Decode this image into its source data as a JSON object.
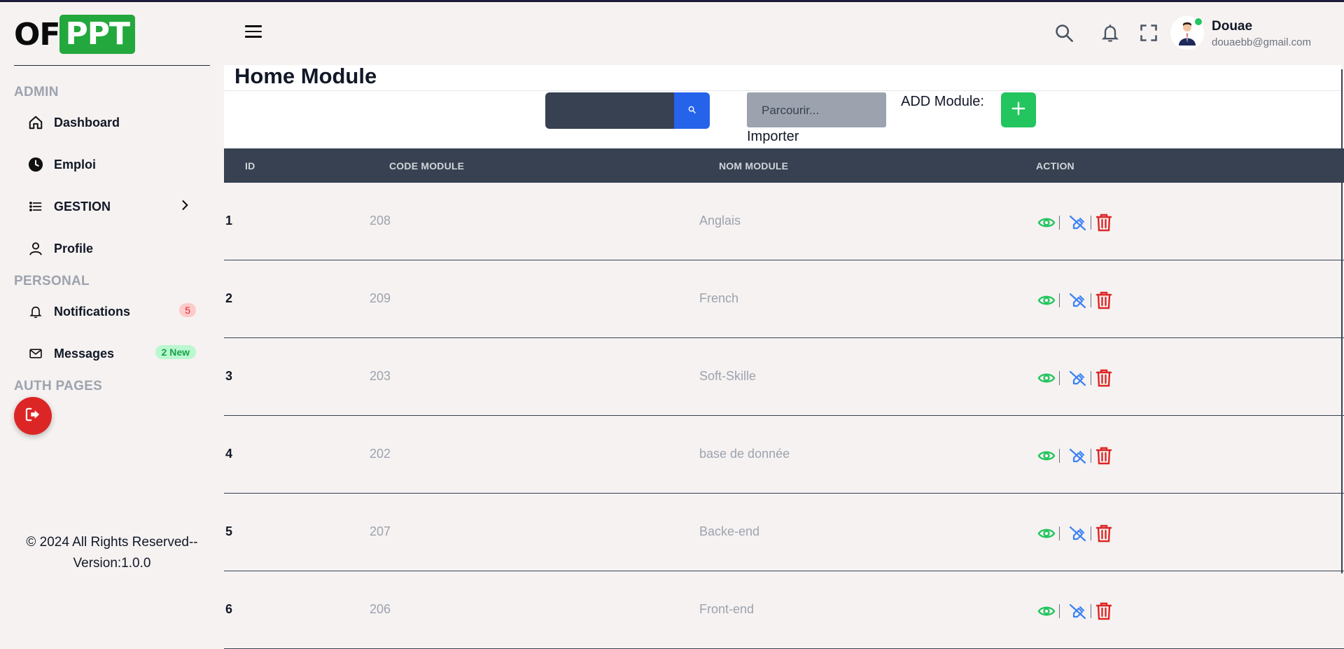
{
  "brand": {
    "logo_prefix": "OF",
    "logo_highlight": "PPT"
  },
  "sidebar": {
    "sections": {
      "admin": "ADMIN",
      "personal": "PERSONAL",
      "auth": "AUTH PAGES"
    },
    "items": [
      {
        "label": "Dashboard",
        "icon": "home-icon"
      },
      {
        "label": "Emploi",
        "icon": "clock-icon"
      },
      {
        "label": "GESTION",
        "icon": "list-icon"
      },
      {
        "label": "Profile",
        "icon": "user-icon"
      },
      {
        "label": "Notifications",
        "icon": "bell-icon",
        "badge": "5"
      },
      {
        "label": "Messages",
        "icon": "mail-icon",
        "badge": "2 New"
      }
    ],
    "logout_icon": "logout-icon",
    "footer": {
      "line1": "© 2024 All Rights Reserved--",
      "line2": "Version:1.0.0"
    }
  },
  "header": {
    "menu_icon": "hamburger-icon",
    "icons": [
      "search-icon",
      "bell-icon",
      "fullscreen-icon"
    ],
    "user": {
      "name": "Douae",
      "email": "douaebb@gmail.com",
      "status_color": "#22c55e"
    }
  },
  "main": {
    "title": "Home Module",
    "search": {
      "value": "",
      "placeholder": ""
    },
    "file_input_placeholder": "Parcourir...",
    "import_label": "Importer",
    "add_label": "ADD Module:",
    "table": {
      "columns": [
        "ID",
        "CODE MODULE",
        "NOM MODULE",
        "ACTION"
      ],
      "rows": [
        {
          "id": "1",
          "code": "208",
          "nom": "Anglais"
        },
        {
          "id": "2",
          "code": "209",
          "nom": "French"
        },
        {
          "id": "3",
          "code": "203",
          "nom": "Soft-Skille"
        },
        {
          "id": "4",
          "code": "202",
          "nom": "base de donnée"
        },
        {
          "id": "5",
          "code": "207",
          "nom": "Backe-end"
        },
        {
          "id": "6",
          "code": "206",
          "nom": "Front-end"
        }
      ],
      "action_icons": [
        "eye-icon",
        "edit-icon",
        "trash-icon"
      ]
    }
  },
  "colors": {
    "brand_green": "#22a83c",
    "header_dark": "#374151",
    "search_blue": "#2563eb",
    "add_green": "#22c55e",
    "danger_red": "#dc2626",
    "view_green": "#22c55e",
    "edit_blue": "#3b82f6"
  }
}
